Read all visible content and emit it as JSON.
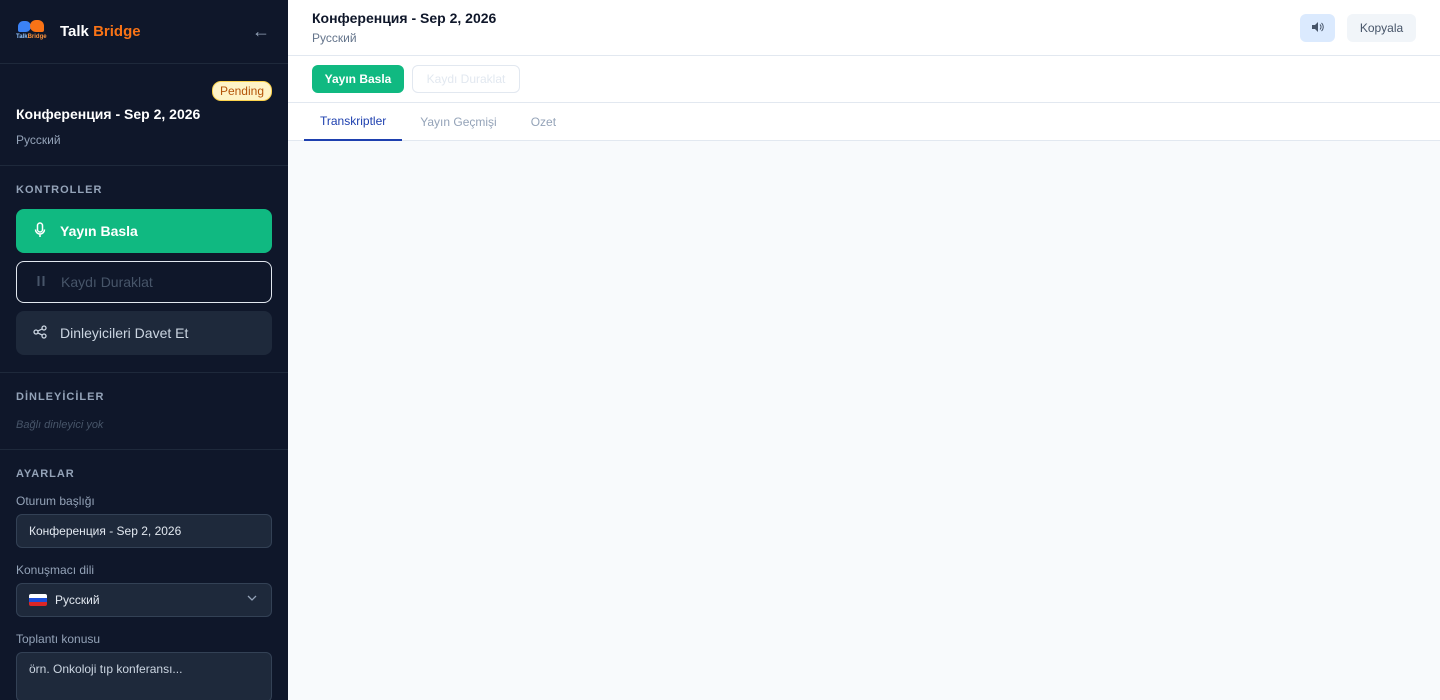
{
  "brand": {
    "name_part1": "Talk",
    "name_part2": "Bridge",
    "logo_text1": "Talk",
    "logo_text2": "Bridge"
  },
  "sidebar": {
    "session": {
      "status": "Pending",
      "title": "Конференция - Sep 2, 2026",
      "language": "Русский"
    },
    "controls": {
      "heading": "KONTROLLER",
      "start": "Yayın Basla",
      "pause": "Kaydı Duraklat",
      "invite": "Dinleyicileri Davet Et"
    },
    "listeners": {
      "heading": "DİNLEYİCİLER",
      "empty": "Bağlı dinleyici yok"
    },
    "settings": {
      "heading": "AYARLAR",
      "title_label": "Oturum başlığı",
      "title_value": "Конференция - Sep 2, 2026",
      "lang_label": "Konuşmacı dili",
      "lang_value": "Русский",
      "topic_label": "Toplantı konusu",
      "topic_placeholder": "örn. Onkoloji tıp konferansı..."
    }
  },
  "topbar": {
    "title": "Конференция - Sep 2, 2026",
    "language": "Русский",
    "copy": "Kopyala"
  },
  "actionbar": {
    "start": "Yayın Basla",
    "pause": "Kaydı Duraklat"
  },
  "tabs": [
    {
      "label": "Transkriptler",
      "active": true
    },
    {
      "label": "Yayın Geçmişi",
      "active": false
    },
    {
      "label": "Ozet",
      "active": false
    }
  ],
  "colors": {
    "accent": "#10b981",
    "brand_orange": "#f97316",
    "sidebar_bg": "#0f172a",
    "tab_active": "#1e40af"
  },
  "icons": {
    "collapse": "arrow-left-icon",
    "start": "microphone-icon",
    "pause": "pause-icon",
    "invite": "share-icon",
    "sound": "speaker-icon",
    "select": "chevron-down-icon"
  }
}
